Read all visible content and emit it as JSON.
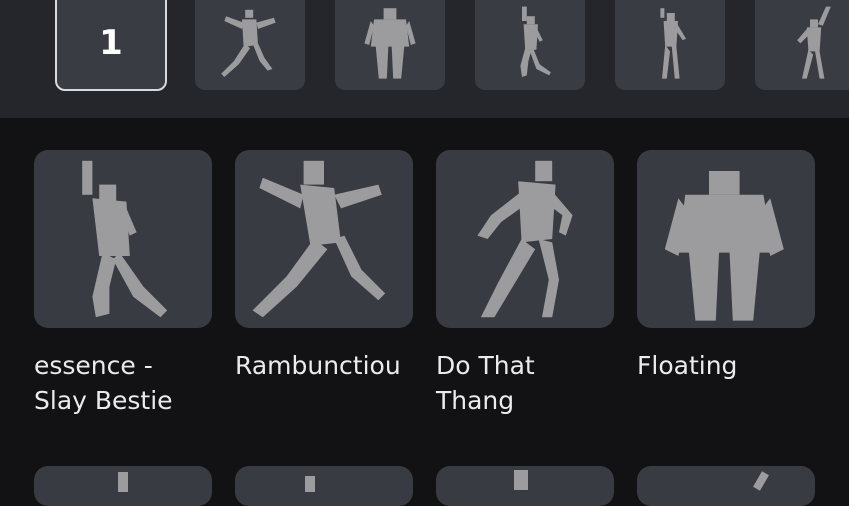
{
  "slots": {
    "selected_number": "1",
    "items": [
      {
        "icon": "lunge-figure-icon"
      },
      {
        "icon": "standing-figure-icon"
      },
      {
        "icon": "arm-raised-figure-icon"
      },
      {
        "icon": "waving-figure-icon"
      },
      {
        "icon": "reaching-figure-icon"
      }
    ]
  },
  "emotes": [
    {
      "line1": "essence -",
      "line2": "Slay Bestie",
      "icon": "cheer-figure-icon"
    },
    {
      "line1": "",
      "line2": "Rambunctiou",
      "icon": "lunge-figure-icon"
    },
    {
      "line1": "Do That",
      "line2": "Thang",
      "icon": "dancing-figure-icon"
    },
    {
      "line1": "Floating",
      "line2": "",
      "icon": "bulky-figure-icon"
    }
  ],
  "colors": {
    "background": "#121214",
    "slot_bar": "#24262c",
    "tile": "#393b42",
    "figure": "#9c9c9e",
    "selected_border": "#d9dadd"
  }
}
